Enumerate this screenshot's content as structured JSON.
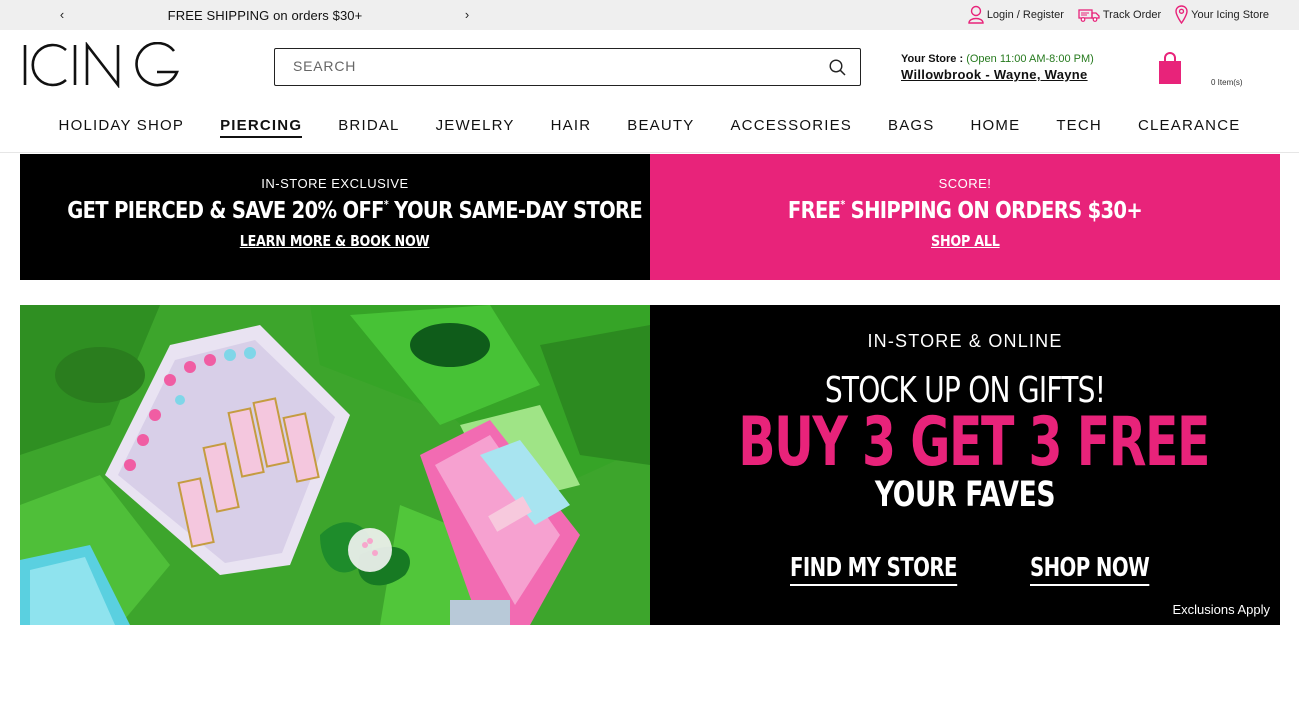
{
  "topbar": {
    "promo_text": "FREE SHIPPING on orders $30+",
    "prev_arrow": "‹",
    "next_arrow": "›",
    "links": {
      "login": "Login / Register",
      "track": "Track Order",
      "store": "Your Icing Store"
    }
  },
  "header": {
    "logo_text": "ICING",
    "search_placeholder": "SEARCH",
    "store_label": "Your Store :",
    "store_hours": "(Open 11:00 AM-8:00 PM)",
    "store_name": "Willowbrook - Wayne, Wayne",
    "cart_count": "0 Item(s)"
  },
  "nav": {
    "items": [
      "HOLIDAY SHOP",
      "PIERCING",
      "BRIDAL",
      "JEWELRY",
      "HAIR",
      "BEAUTY",
      "ACCESSORIES",
      "BAGS",
      "HOME",
      "TECH",
      "CLEARANCE"
    ],
    "active": "PIERCING"
  },
  "banners": {
    "left": {
      "eyebrow": "IN-STORE EXCLUSIVE",
      "headline_a": "GET PIERCED & SAVE 20% OFF",
      "headline_sup": "*",
      "headline_b": " YOUR SAME-DAY STORE PURCHASE",
      "cta": "LEARN MORE & BOOK NOW"
    },
    "right": {
      "eyebrow": "SCORE!",
      "headline_a": "FREE",
      "headline_sup": "*",
      "headline_b": " SHIPPING ON ORDERS $30+",
      "cta": "SHOP ALL"
    }
  },
  "hero": {
    "eyebrow": "IN-STORE & ONLINE",
    "line1": "STOCK UP ON GIFTS!",
    "line2": "BUY 3 GET 3 FREE",
    "line3": "YOUR FAVES",
    "cta_find": "FIND MY STORE",
    "cta_shop": "SHOP NOW",
    "disclaimer": "Exclusions Apply"
  },
  "colors": {
    "brand_pink": "#e8237a",
    "hours_green": "#267a1e",
    "topbar_bg": "#efefef"
  }
}
